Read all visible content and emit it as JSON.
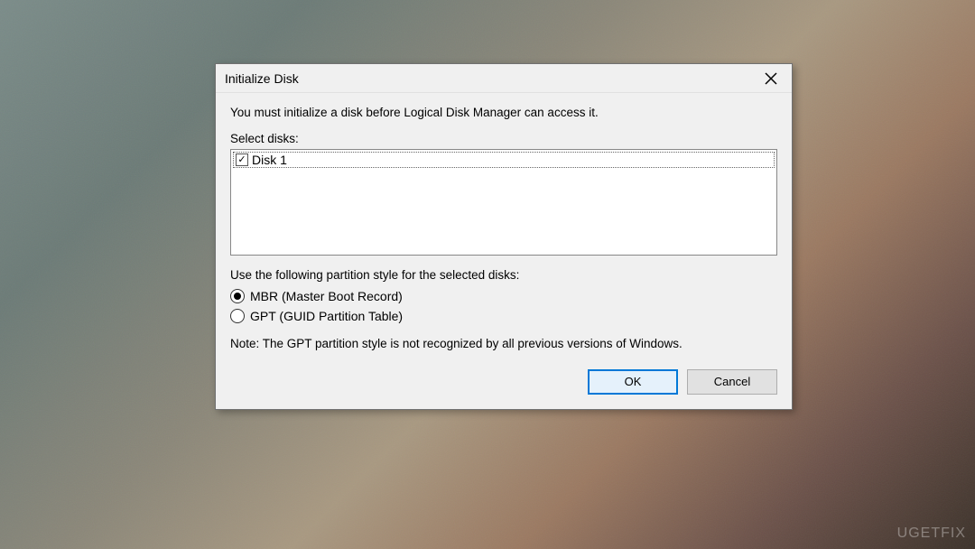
{
  "dialog": {
    "title": "Initialize Disk",
    "instruction": "You must initialize a disk before Logical Disk Manager can access it.",
    "select_label": "Select disks:",
    "disks": [
      {
        "label": "Disk 1",
        "checked": true
      }
    ],
    "partition_label": "Use the following partition style for the selected disks:",
    "radios": {
      "mbr": "MBR (Master Boot Record)",
      "gpt": "GPT (GUID Partition Table)"
    },
    "note": "Note: The GPT partition style is not recognized by all previous versions of Windows.",
    "buttons": {
      "ok": "OK",
      "cancel": "Cancel"
    }
  },
  "watermark": "UGETFIX"
}
